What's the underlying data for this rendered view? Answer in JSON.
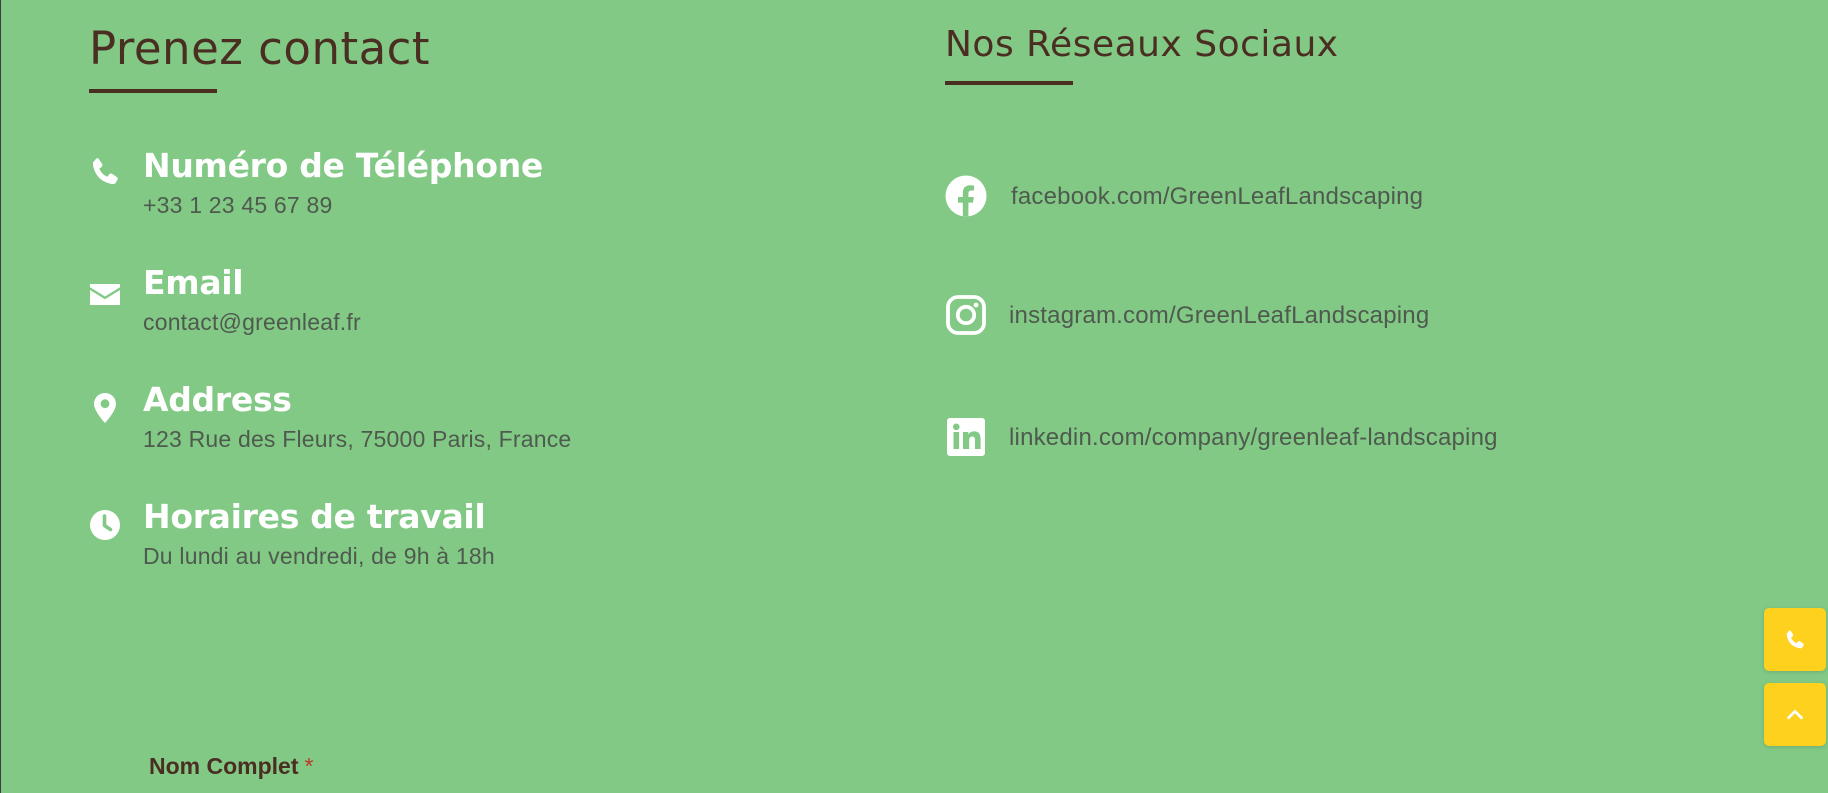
{
  "contact": {
    "heading": "Prenez contact",
    "items": [
      {
        "icon": "phone-icon",
        "title": "Numéro de Téléphone",
        "value": "+33 1 23 45 67 89"
      },
      {
        "icon": "envelope-icon",
        "title": "Email",
        "value": "contact@greenleaf.fr"
      },
      {
        "icon": "map-pin-icon",
        "title": "Address",
        "value": "123 Rue des Fleurs, 75000 Paris, France"
      },
      {
        "icon": "clock-icon",
        "title": "Horaires de travail",
        "value": "Du lundi au vendredi, de 9h à 18h"
      }
    ]
  },
  "social": {
    "heading": "Nos Réseaux Sociaux",
    "links": [
      {
        "icon": "facebook-icon",
        "text": "facebook.com/GreenLeafLandscaping"
      },
      {
        "icon": "instagram-icon",
        "text": "instagram.com/GreenLeafLandscaping"
      },
      {
        "icon": "linkedin-icon",
        "text": "linkedin.com/company/greenleaf-landscaping"
      }
    ]
  },
  "form": {
    "name_label": "Nom Complet",
    "required_mark": "*"
  },
  "floating": {
    "call_icon": "phone-icon",
    "top_icon": "chevron-up-icon"
  },
  "colors": {
    "background": "#81c985",
    "heading": "#4a2e22",
    "accent_button": "#fdd11d",
    "text_muted": "#4f5a4f",
    "required": "#c0392b"
  }
}
